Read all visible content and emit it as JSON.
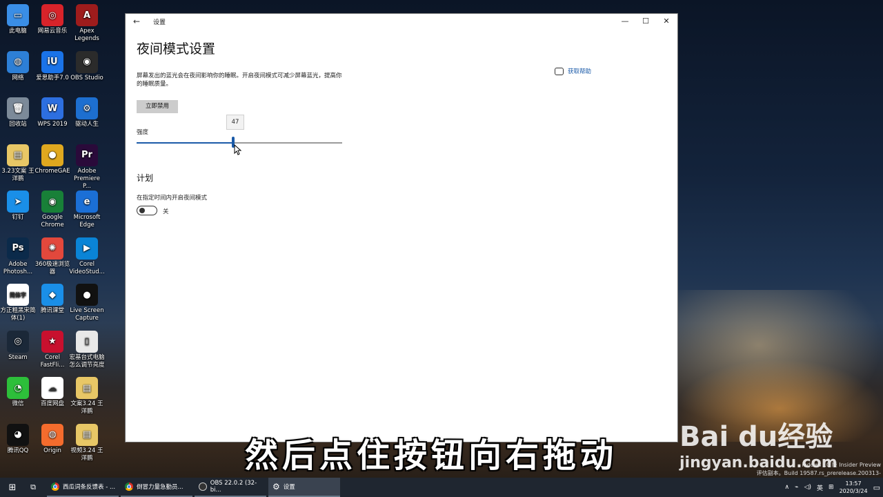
{
  "desktop": {
    "icons": [
      {
        "label": "此电脑",
        "glyph": "▭",
        "color": "#3a8ee6"
      },
      {
        "label": "网易云音乐",
        "glyph": "◎",
        "color": "#d8232a"
      },
      {
        "label": "Apex Legends",
        "glyph": "A",
        "color": "#9e1c1c"
      },
      {
        "label": "网络",
        "glyph": "◍",
        "color": "#2d7fd6"
      },
      {
        "label": "爱思助手7.0",
        "glyph": "iU",
        "color": "#1a73e8"
      },
      {
        "label": "OBS Studio",
        "glyph": "◉",
        "color": "#2b2b2b"
      },
      {
        "label": "回收站",
        "glyph": "🗑",
        "color": "#7c8a99"
      },
      {
        "label": "WPS 2019",
        "glyph": "W",
        "color": "#2d6fe0"
      },
      {
        "label": "驱动人生",
        "glyph": "⚙",
        "color": "#1d6fd0"
      },
      {
        "label": "3.23文案 王洋鹏",
        "glyph": "▤",
        "color": "#e8c766"
      },
      {
        "label": "ChromeGAE",
        "glyph": "●",
        "color": "#e0a81f"
      },
      {
        "label": "Adobe Premiere P...",
        "glyph": "Pr",
        "color": "#2a0a3a"
      },
      {
        "label": "钉钉",
        "glyph": "➤",
        "color": "#1a8fe8"
      },
      {
        "label": "Google Chrome",
        "glyph": "◉",
        "color": "#188038"
      },
      {
        "label": "Microsoft Edge",
        "glyph": "e",
        "color": "#1b6fd6"
      },
      {
        "label": "Adobe Photosh...",
        "glyph": "Ps",
        "color": "#0b2a4a"
      },
      {
        "label": "360极速浏览器",
        "glyph": "✺",
        "color": "#e2483c"
      },
      {
        "label": "Corel VideoStud...",
        "glyph": "▶",
        "color": "#0a84d6"
      },
      {
        "label": "方正粗黑宋简体(1)",
        "glyph": "简体字",
        "color": "#ffffff"
      },
      {
        "label": "腾讯课堂",
        "glyph": "◆",
        "color": "#1a8fe8"
      },
      {
        "label": "Live Screen Capture",
        "glyph": "●",
        "color": "#111111"
      },
      {
        "label": "Steam",
        "glyph": "◎",
        "color": "#1b2838"
      },
      {
        "label": "Corel FastFli...",
        "glyph": "★",
        "color": "#c8102e"
      },
      {
        "label": "宏基台式电脑 怎么调节亮度",
        "glyph": "▯",
        "color": "#e8e8e8"
      },
      {
        "label": "微信",
        "glyph": "◔",
        "color": "#2dbf3a"
      },
      {
        "label": "百度网盘",
        "glyph": "☁",
        "color": "#ffffff"
      },
      {
        "label": "文案3.24 王洋鹏",
        "glyph": "▤",
        "color": "#e8c766"
      },
      {
        "label": "腾讯QQ",
        "glyph": "◕",
        "color": "#111111"
      },
      {
        "label": "Origin",
        "glyph": "◍",
        "color": "#f56c2d"
      },
      {
        "label": "视频3.24 王洋鹏",
        "glyph": "▤",
        "color": "#e8c766"
      }
    ]
  },
  "window": {
    "title": "设置",
    "heading": "夜间模式设置",
    "description": "屏幕发出的蓝光会在夜间影响你的睡眠。开启夜间模式可减少屏幕蓝光，提高你的睡眠质量。",
    "help_link": "获取帮助",
    "disable_button": "立即禁用",
    "strength_label": "强度",
    "strength_value": "47",
    "strength_fraction": 0.47,
    "schedule_title": "计划",
    "schedule_label": "在指定时间内开启夜间模式",
    "schedule_toggle_state": "关"
  },
  "overlay": {
    "subtitle": "然后点住按钮向右拖动",
    "baidu_logo": "Bai du经验",
    "baidu_url": "jingyan.baidu.com",
    "watermark_line1": "indows 10 版 Insider Preview",
    "watermark_line2": "评估副本。Build 19587.rs_prerelease.200313-1639"
  },
  "taskbar": {
    "apps": [
      {
        "label": "西瓜词条反馈表 - ...",
        "icon": "chrome-icon"
      },
      {
        "label": "倒冒力量急勤员...",
        "icon": "chrome-icon"
      },
      {
        "label": "OBS 22.0.2 (32-bi...",
        "icon": "obs-icon"
      },
      {
        "label": "设置",
        "icon": "gear-icon"
      }
    ],
    "ime": "英",
    "time": "13:57",
    "date": "2020/3/24"
  }
}
